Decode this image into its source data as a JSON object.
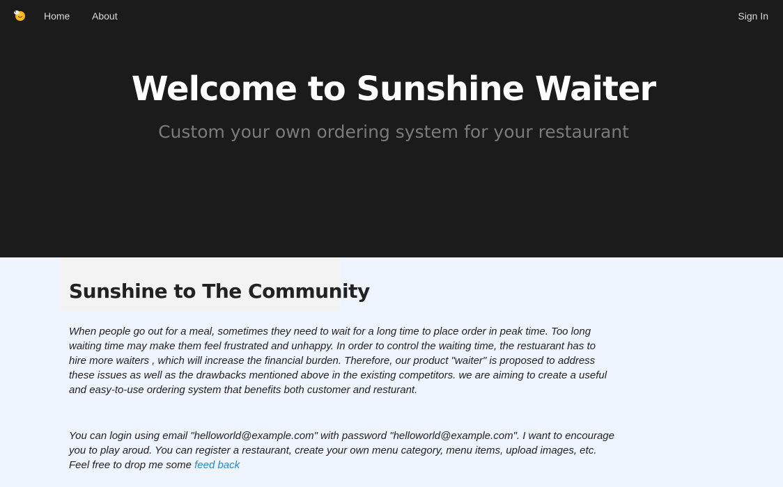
{
  "nav": {
    "home": "Home",
    "about": "About",
    "sign_in": "Sign In",
    "logo_icon": "sunshine-waiter-logo-icon"
  },
  "hero": {
    "title": "Welcome to Sunshine Waiter",
    "subtitle": "Custom your own ordering system for your restaurant"
  },
  "community": {
    "title": "Sunshine to The Community",
    "paragraph1": "When people go out for a meal, sometimes they need to wait for a long time to place order in peak time. Too long waiting time may make them feel frustrated and unhappy. In order to control the waiting time, the restuarant has to hire more waiters , which will increase the financial burden. Therefore, our product \"waiter\" is proposed to address these issues as well as the drawbacks mentioned above in the existing competitors. we are aiming to create a useful and easy-to-use ordering system that benefits both customer and resturant.",
    "paragraph2": "You can login using email \"helloworld@example.com\" with password \"helloworld@example.com\". I want to encourage you to play aroud. You can register a restaurant, create your own menu category, menu items, upload images, etc. Feel free to drop me some",
    "feedback_link": "feed back"
  },
  "colors": {
    "navbar_bg": "#1b1b1c",
    "body_bg": "#eef5fe",
    "link": "#1e88e5"
  }
}
